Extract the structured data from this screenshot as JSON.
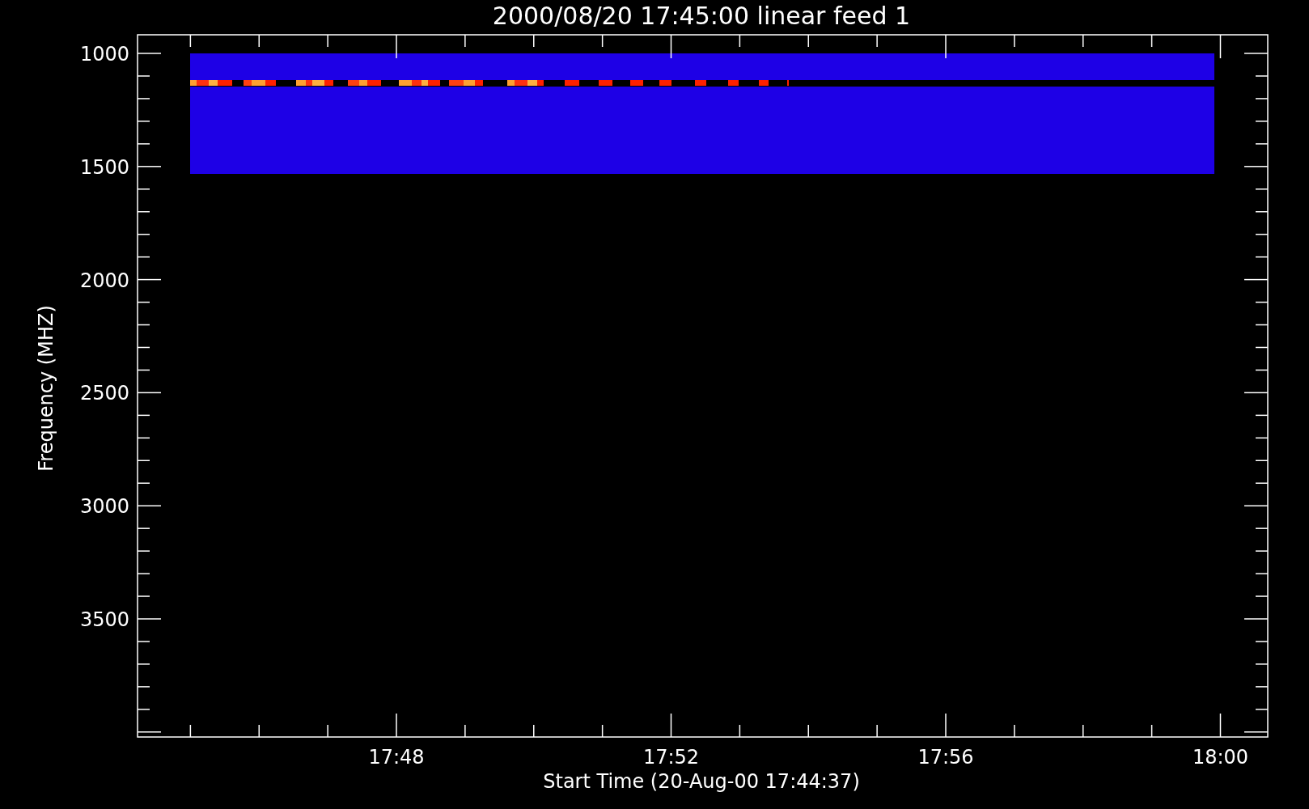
{
  "title": "2000/08/20 17:45:00 linear feed 1",
  "y_axis": {
    "label": "Frequency (MHZ)",
    "ticks": [
      "1000",
      "1500",
      "2000",
      "2500",
      "3000",
      "3500"
    ]
  },
  "x_axis": {
    "label": "Start Time (20-Aug-00 17:44:37)",
    "ticks": [
      "17:48",
      "17:52",
      "17:56",
      "18:00"
    ]
  }
}
